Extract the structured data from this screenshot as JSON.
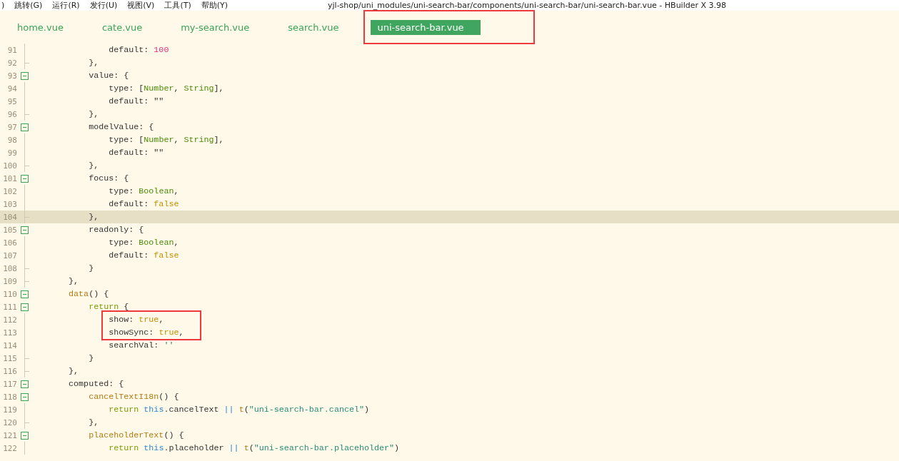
{
  "menu_bar": {
    "items": [
      ")",
      "跳转(G)",
      "运行(R)",
      "发行(U)",
      "视图(V)",
      "工具(T)",
      "帮助(Y)"
    ],
    "title": "yjl-shop/uni_modules/uni-search-bar/components/uni-search-bar/uni-search-bar.vue - HBuilder X 3.98"
  },
  "tabs": [
    {
      "label": "home.vue",
      "selected": false,
      "annotated": false
    },
    {
      "label": "cate.vue",
      "selected": false,
      "annotated": false
    },
    {
      "label": "my-search.vue",
      "selected": false,
      "annotated": false
    },
    {
      "label": "search.vue",
      "selected": false,
      "annotated": false
    },
    {
      "label": "uni-search-bar.vue",
      "selected": true,
      "annotated": true
    }
  ],
  "editor": {
    "lines": [
      {
        "children": [
          {
            "children": [
              {
                "number": "91",
                "kind": "plain",
                "current": false,
                "boxed": false,
                "tokens": [
                  {
                    "text": "default: ",
                    "kind": "plain"
                  },
                  {
                    "text": "100",
                    "kind": "number"
                  }
                ]
              }
            ]
          },
          {
            "number": "92",
            "kind": "close",
            "current": false,
            "boxed": false,
            "tokens": [
              {
                "text": "},",
                "kind": "plain"
              }
            ]
          },
          {
            "number": "93",
            "kind": "open",
            "current": false,
            "boxed": false,
            "tokens": [
              {
                "text": "value: {",
                "kind": "plain"
              }
            ],
            "children": [
              {
                "number": "94",
                "kind": "plain",
                "current": false,
                "boxed": false,
                "tokens": [
                  {
                    "text": "type: [",
                    "kind": "plain"
                  },
                  {
                    "text": "Number",
                    "kind": "type"
                  },
                  {
                    "text": ", ",
                    "kind": "plain"
                  },
                  {
                    "text": "String",
                    "kind": "type"
                  },
                  {
                    "text": "],",
                    "kind": "plain"
                  }
                ]
              },
              {
                "number": "95",
                "kind": "plain",
                "current": false,
                "boxed": false,
                "tokens": [
                  {
                    "text": "default: \"\"",
                    "kind": "plain"
                  }
                ]
              }
            ]
          },
          {
            "number": "96",
            "kind": "close",
            "current": false,
            "boxed": false,
            "tokens": [
              {
                "text": "},",
                "kind": "plain"
              }
            ]
          },
          {
            "number": "97",
            "kind": "open",
            "current": false,
            "boxed": false,
            "tokens": [
              {
                "text": "modelValue: {",
                "kind": "plain"
              }
            ],
            "children": [
              {
                "number": "98",
                "kind": "plain",
                "current": false,
                "boxed": false,
                "tokens": [
                  {
                    "text": "type: [",
                    "kind": "plain"
                  },
                  {
                    "text": "Number",
                    "kind": "type"
                  },
                  {
                    "text": ", ",
                    "kind": "plain"
                  },
                  {
                    "text": "String",
                    "kind": "type"
                  },
                  {
                    "text": "],",
                    "kind": "plain"
                  }
                ]
              },
              {
                "number": "99",
                "kind": "plain",
                "current": false,
                "boxed": false,
                "tokens": [
                  {
                    "text": "default: \"\"",
                    "kind": "plain"
                  }
                ]
              }
            ]
          },
          {
            "number": "100",
            "kind": "close",
            "current": false,
            "boxed": false,
            "tokens": [
              {
                "text": "},",
                "kind": "plain"
              }
            ]
          },
          {
            "number": "101",
            "kind": "open",
            "current": false,
            "boxed": false,
            "tokens": [
              {
                "text": "focus: {",
                "kind": "plain"
              }
            ],
            "children": [
              {
                "number": "102",
                "kind": "plain",
                "current": false,
                "boxed": false,
                "tokens": [
                  {
                    "text": "type: ",
                    "kind": "plain"
                  },
                  {
                    "text": "Boolean",
                    "kind": "type"
                  },
                  {
                    "text": ",",
                    "kind": "plain"
                  }
                ]
              },
              {
                "number": "103",
                "kind": "plain",
                "current": false,
                "boxed": false,
                "tokens": [
                  {
                    "text": "default: ",
                    "kind": "plain"
                  },
                  {
                    "text": "false",
                    "kind": "literal"
                  }
                ]
              }
            ]
          },
          {
            "number": "104",
            "kind": "close",
            "current": true,
            "boxed": false,
            "tokens": [
              {
                "text": "},",
                "kind": "plain"
              }
            ]
          },
          {
            "number": "105",
            "kind": "open",
            "current": false,
            "boxed": false,
            "tokens": [
              {
                "text": "readonly: {",
                "kind": "plain"
              }
            ],
            "children": [
              {
                "number": "106",
                "kind": "plain",
                "current": false,
                "boxed": false,
                "tokens": [
                  {
                    "text": "type: ",
                    "kind": "plain"
                  },
                  {
                    "text": "Boolean",
                    "kind": "type"
                  },
                  {
                    "text": ",",
                    "kind": "plain"
                  }
                ]
              },
              {
                "number": "107",
                "kind": "plain",
                "current": false,
                "boxed": false,
                "tokens": [
                  {
                    "text": "default: ",
                    "kind": "plain"
                  },
                  {
                    "text": "false",
                    "kind": "literal"
                  }
                ]
              }
            ]
          },
          {
            "number": "108",
            "kind": "close",
            "current": false,
            "boxed": false,
            "tokens": [
              {
                "text": "}",
                "kind": "plain"
              }
            ]
          }
        ]
      },
      {
        "number": "109",
        "kind": "close",
        "current": false,
        "boxed": false,
        "tokens": [
          {
            "text": "},",
            "kind": "plain"
          }
        ]
      },
      {
        "number": "110",
        "kind": "open",
        "current": false,
        "boxed": false,
        "tokens": [
          {
            "text": "data",
            "kind": "function"
          },
          {
            "text": "() {",
            "kind": "plain"
          }
        ],
        "children": [
          {
            "number": "111",
            "kind": "open",
            "current": false,
            "boxed": false,
            "tokens": [
              {
                "text": "return",
                "kind": "keyword"
              },
              {
                "text": " {",
                "kind": "plain"
              }
            ],
            "children": [
              {
                "number": "112",
                "kind": "plain",
                "current": false,
                "boxed": true,
                "tokens": [
                  {
                    "text": "show: ",
                    "kind": "plain"
                  },
                  {
                    "text": "true",
                    "kind": "literal"
                  },
                  {
                    "text": ",",
                    "kind": "plain"
                  }
                ]
              },
              {
                "number": "113",
                "kind": "plain",
                "current": false,
                "boxed": true,
                "tokens": [
                  {
                    "text": "showSync: ",
                    "kind": "plain"
                  },
                  {
                    "text": "true",
                    "kind": "literal"
                  },
                  {
                    "text": ",",
                    "kind": "plain"
                  }
                ]
              },
              {
                "number": "114",
                "kind": "plain",
                "current": false,
                "boxed": false,
                "tokens": [
                  {
                    "text": "searchVal: ",
                    "kind": "plain"
                  },
                  {
                    "text": "''",
                    "kind": "string"
                  }
                ]
              }
            ]
          },
          {
            "number": "115",
            "kind": "close",
            "current": false,
            "boxed": false,
            "tokens": [
              {
                "text": "}",
                "kind": "plain"
              }
            ]
          }
        ]
      },
      {
        "number": "116",
        "kind": "close",
        "current": false,
        "boxed": false,
        "tokens": [
          {
            "text": "},",
            "kind": "plain"
          }
        ]
      },
      {
        "number": "117",
        "kind": "open",
        "current": false,
        "boxed": false,
        "tokens": [
          {
            "text": "computed: {",
            "kind": "plain"
          }
        ],
        "children": [
          {
            "number": "118",
            "kind": "open",
            "current": false,
            "boxed": false,
            "tokens": [
              {
                "text": "cancelTextI18n",
                "kind": "function"
              },
              {
                "text": "() {",
                "kind": "plain"
              }
            ],
            "children": [
              {
                "number": "119",
                "kind": "plain",
                "current": false,
                "boxed": false,
                "tokens": [
                  {
                    "text": "return ",
                    "kind": "keyword"
                  },
                  {
                    "text": "this",
                    "kind": "this"
                  },
                  {
                    "text": ".cancelText ",
                    "kind": "plain"
                  },
                  {
                    "text": "|| ",
                    "kind": "this"
                  },
                  {
                    "text": "t",
                    "kind": "function"
                  },
                  {
                    "text": "(",
                    "kind": "plain"
                  },
                  {
                    "text": "\"uni-search-bar.cancel\"",
                    "kind": "string"
                  },
                  {
                    "text": ")",
                    "kind": "plain"
                  }
                ]
              }
            ]
          },
          {
            "number": "120",
            "kind": "close",
            "current": false,
            "boxed": false,
            "tokens": [
              {
                "text": "},",
                "kind": "plain"
              }
            ]
          },
          {
            "number": "121",
            "kind": "open",
            "current": false,
            "boxed": false,
            "tokens": [
              {
                "text": "placeholderText",
                "kind": "function"
              },
              {
                "text": "() {",
                "kind": "plain"
              }
            ],
            "children": [
              {
                "number": "122",
                "kind": "plain",
                "current": false,
                "boxed": false,
                "tokens": [
                  {
                    "text": "return ",
                    "kind": "keyword"
                  },
                  {
                    "text": "this",
                    "kind": "this"
                  },
                  {
                    "text": ".placeholder ",
                    "kind": "plain"
                  },
                  {
                    "text": "|| ",
                    "kind": "this"
                  },
                  {
                    "text": "t",
                    "kind": "function"
                  },
                  {
                    "text": "(",
                    "kind": "plain"
                  },
                  {
                    "text": "\"uni-search-bar.placeholder\"",
                    "kind": "string"
                  },
                  {
                    "text": ")",
                    "kind": "plain"
                  }
                ]
              }
            ]
          }
        ]
      }
    ]
  }
}
